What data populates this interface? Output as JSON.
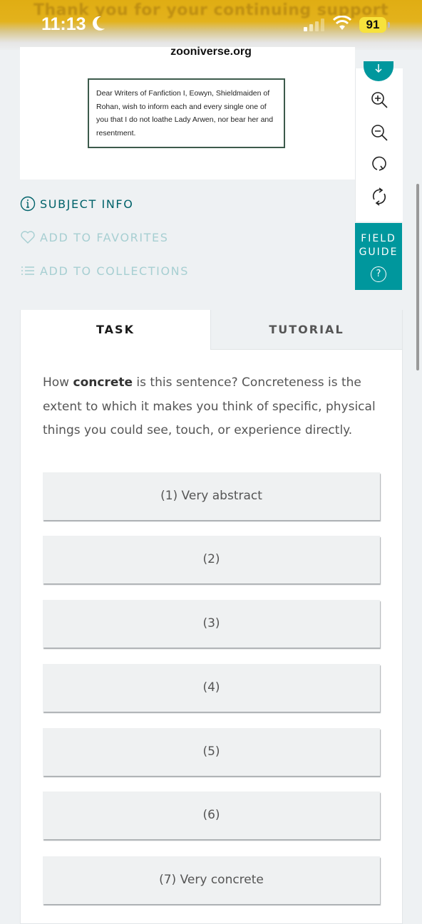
{
  "status_bar": {
    "banner": "Thank you for your continuing support",
    "time": "11:13",
    "battery": "91"
  },
  "browser": {
    "url": "zooniverse.org"
  },
  "subject": {
    "text": "Dear Writers of Fanfiction I, Eowyn, Shieldmaiden of Rohan, wish to inform each and every single one of you that I do not loathe Lady Arwen, nor bear her and resentment."
  },
  "field_guide": {
    "label_line1": "FIELD",
    "label_line2": "GUIDE",
    "help": "?"
  },
  "meta": {
    "subject_info": "SUBJECT INFO",
    "add_to_favorites": "ADD TO FAVORITES",
    "add_to_collections": "ADD TO COLLECTIONS"
  },
  "tabs": {
    "task": "TASK",
    "tutorial": "TUTORIAL"
  },
  "question": {
    "prefix": "How ",
    "emphasis": "concrete",
    "suffix": " is this sentence? Concreteness is the extent to which it makes you think of specific, physical things you could see, touch, or experience directly."
  },
  "answers": [
    "(1) Very abstract",
    "(2)",
    "(3)",
    "(4)",
    "(5)",
    "(6)",
    "(7) Very concrete"
  ],
  "colors": {
    "teal": "#00979d",
    "dark_teal": "#00626a",
    "light_teal": "#a7cfd2",
    "status_yellow": "#e3b21c"
  }
}
